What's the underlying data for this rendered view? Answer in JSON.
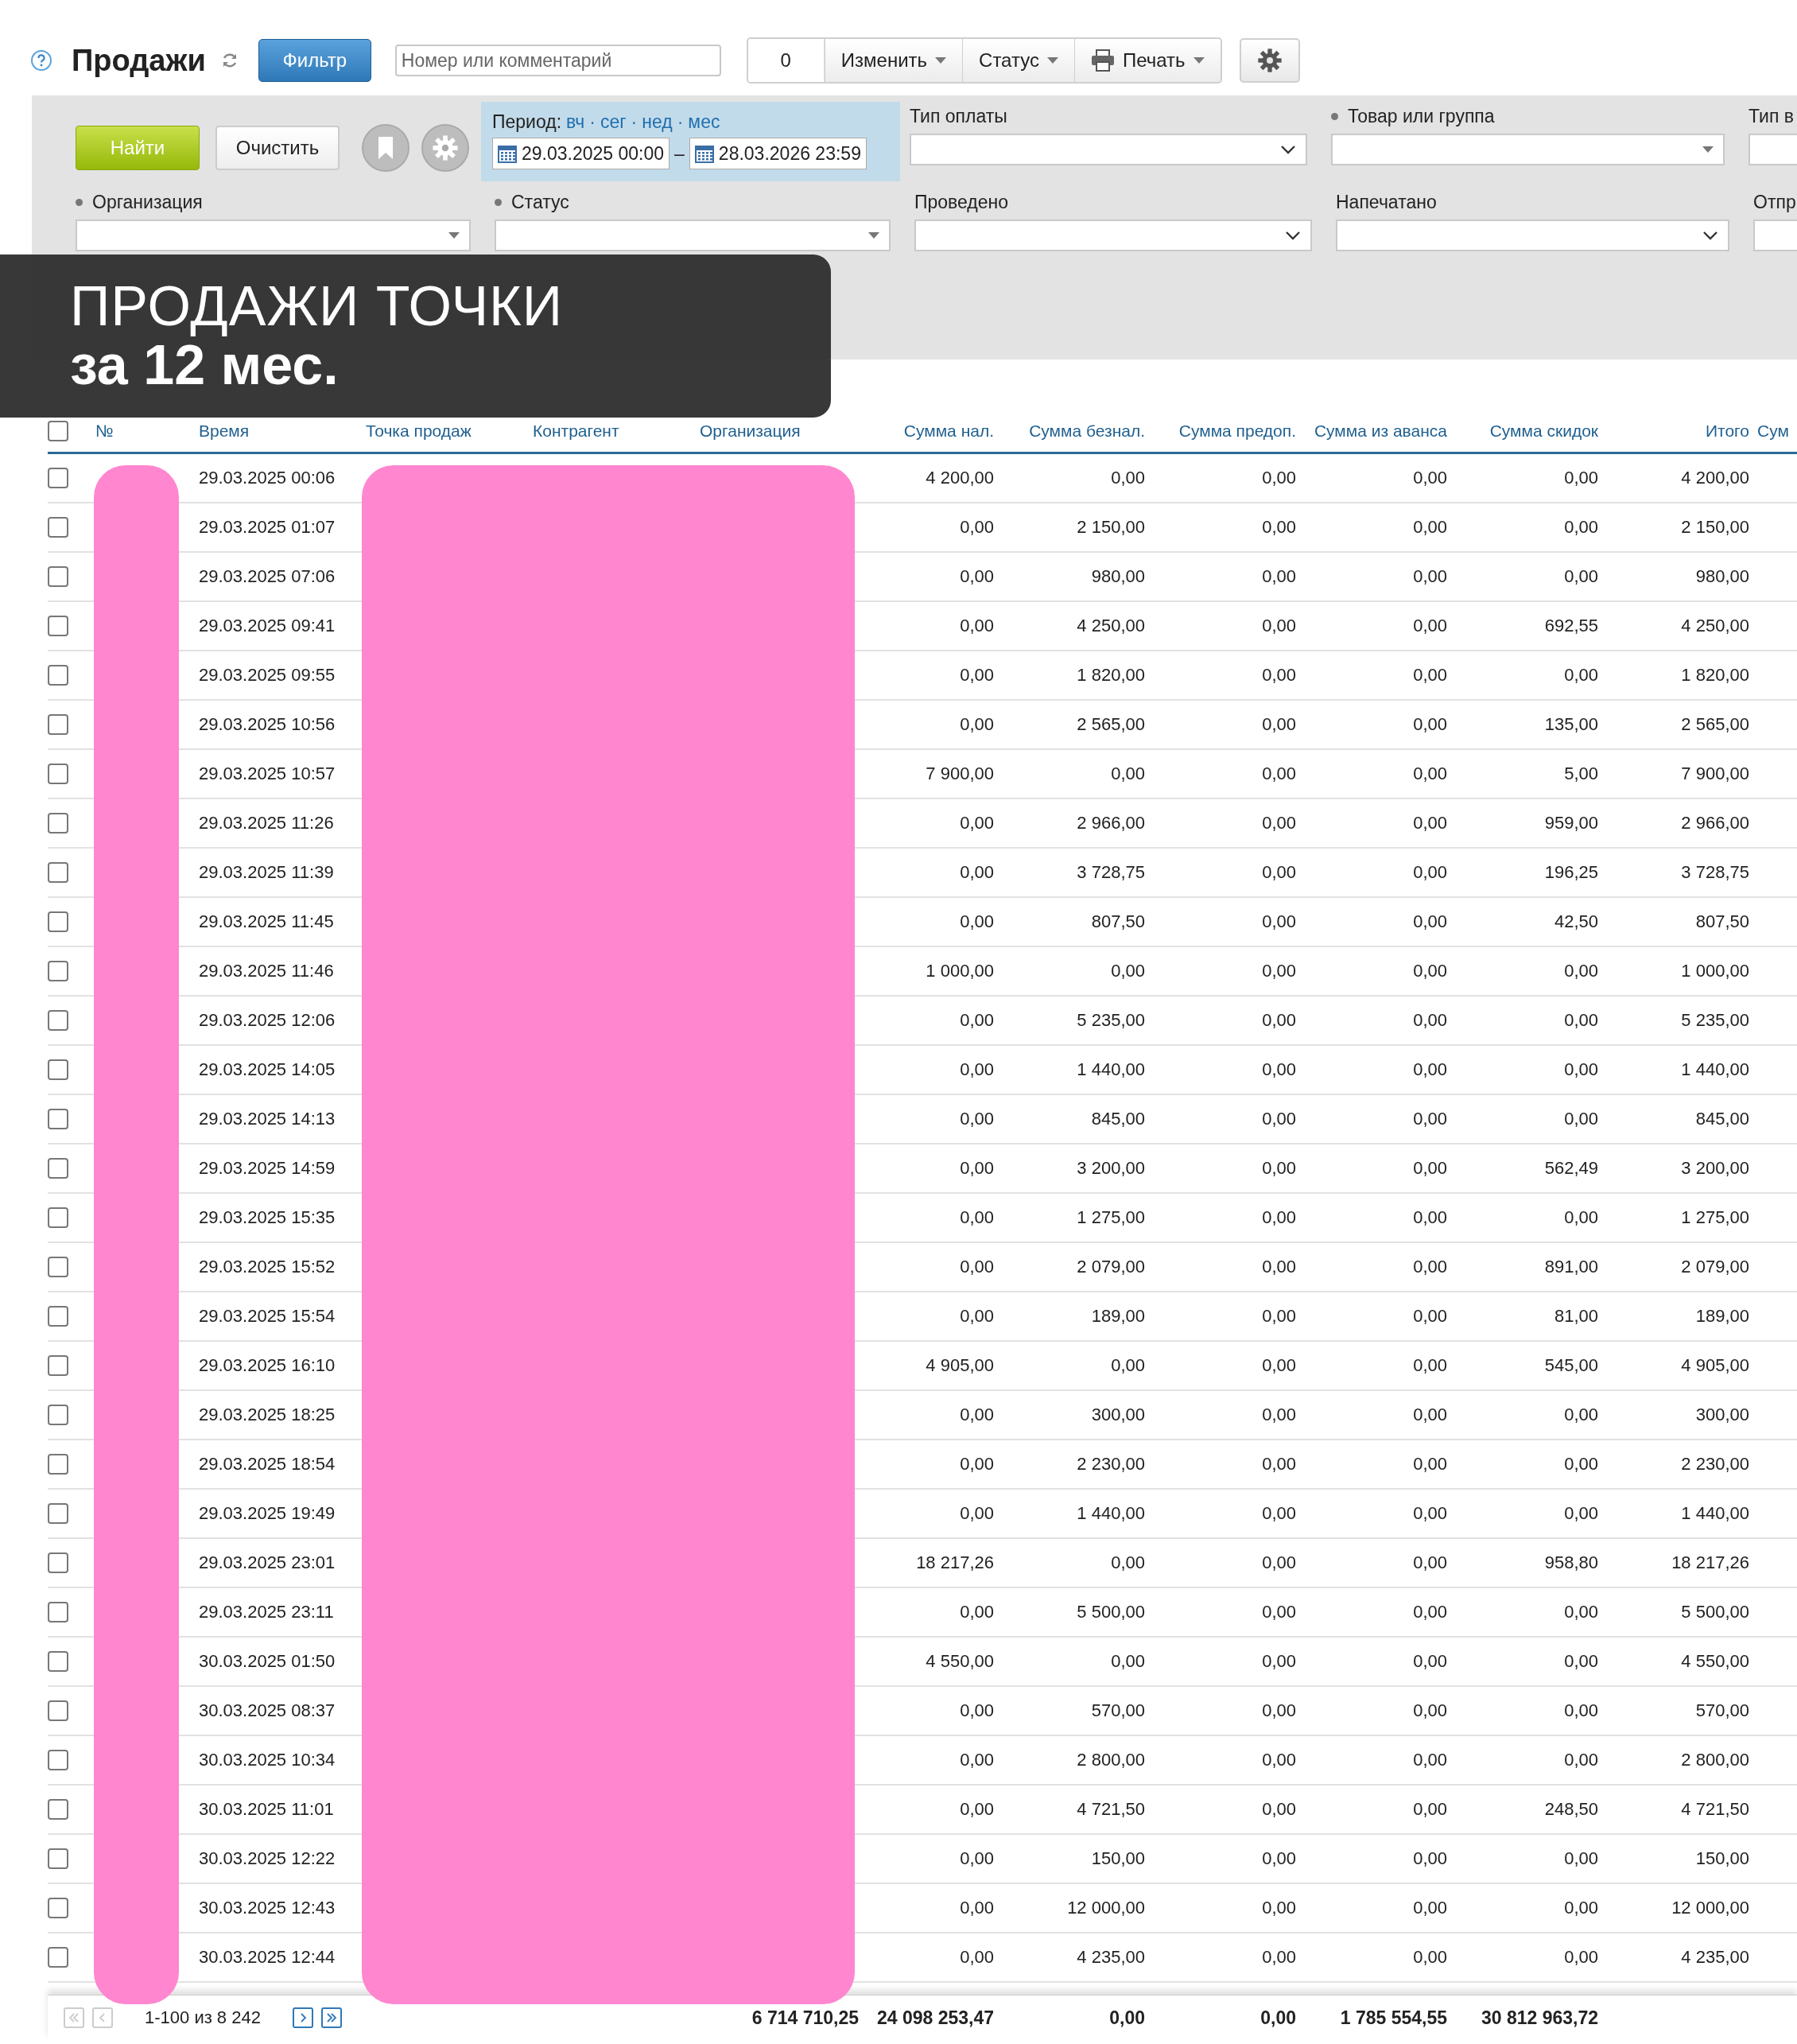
{
  "toolbar": {
    "title": "Продажи",
    "filter_button": "Фильтр",
    "search": {
      "placeholder": "Номер или комментарий"
    },
    "counter": "0",
    "menus": [
      {
        "label": "Изменить",
        "kind": "plain"
      },
      {
        "label": "Статус",
        "kind": "plain"
      },
      {
        "label": "Печать",
        "kind": "print"
      }
    ]
  },
  "filters": {
    "find_button": "Найти",
    "clear_button": "Очистить",
    "period": {
      "label": "Период:",
      "shortcuts": [
        "вч",
        "сег",
        "нед",
        "мес"
      ],
      "shortcut_separator": "·",
      "from": "29.03.2025 00:00",
      "separator": "–",
      "to": "28.03.2026 23:59"
    },
    "top_fields": [
      {
        "label": "Тип оплаты",
        "bullet": false,
        "kind": "select"
      },
      {
        "label": "Товар или группа",
        "bullet": true,
        "kind": "combo"
      },
      {
        "label": "Тип в",
        "bullet": false
      }
    ],
    "fields": [
      {
        "label": "Организация",
        "bullet": true,
        "kind": "combo"
      },
      {
        "label": "Статус",
        "bullet": true,
        "kind": "combo"
      },
      {
        "label": "Проведено",
        "bullet": false,
        "kind": "select"
      },
      {
        "label": "Напечатано",
        "bullet": false,
        "kind": "select"
      },
      {
        "label": "Отпр",
        "bullet": false
      }
    ]
  },
  "banner": {
    "title": "ПРОДАЖИ ТОЧКИ",
    "subtitle": "за 12 мес."
  },
  "table": {
    "header_checked": false,
    "columns": [
      "№",
      "Время",
      "Точка продаж",
      "Контрагент",
      "Организация",
      "Сумма нал.",
      "Сумма безнал.",
      "Сумма предоп.",
      "Сумма из аванса",
      "Сумма скидок",
      "Итого",
      "Сум"
    ],
    "rows": [
      {
        "checked": false,
        "time": "29.03.2025 00:06",
        "amounts": [
          "4 200,00",
          "0,00",
          "0,00",
          "0,00",
          "0,00",
          "4 200,00"
        ]
      },
      {
        "checked": false,
        "time": "29.03.2025 01:07",
        "amounts": [
          "0,00",
          "2 150,00",
          "0,00",
          "0,00",
          "0,00",
          "2 150,00"
        ]
      },
      {
        "checked": false,
        "time": "29.03.2025 07:06",
        "amounts": [
          "0,00",
          "980,00",
          "0,00",
          "0,00",
          "0,00",
          "980,00"
        ]
      },
      {
        "checked": false,
        "time": "29.03.2025 09:41",
        "amounts": [
          "0,00",
          "4 250,00",
          "0,00",
          "0,00",
          "692,55",
          "4 250,00"
        ]
      },
      {
        "checked": false,
        "time": "29.03.2025 09:55",
        "amounts": [
          "0,00",
          "1 820,00",
          "0,00",
          "0,00",
          "0,00",
          "1 820,00"
        ]
      },
      {
        "checked": false,
        "time": "29.03.2025 10:56",
        "amounts": [
          "0,00",
          "2 565,00",
          "0,00",
          "0,00",
          "135,00",
          "2 565,00"
        ]
      },
      {
        "checked": false,
        "time": "29.03.2025 10:57",
        "amounts": [
          "7 900,00",
          "0,00",
          "0,00",
          "0,00",
          "5,00",
          "7 900,00"
        ]
      },
      {
        "checked": false,
        "time": "29.03.2025 11:26",
        "amounts": [
          "0,00",
          "2 966,00",
          "0,00",
          "0,00",
          "959,00",
          "2 966,00"
        ]
      },
      {
        "checked": false,
        "time": "29.03.2025 11:39",
        "amounts": [
          "0,00",
          "3 728,75",
          "0,00",
          "0,00",
          "196,25",
          "3 728,75"
        ]
      },
      {
        "checked": false,
        "time": "29.03.2025 11:45",
        "amounts": [
          "0,00",
          "807,50",
          "0,00",
          "0,00",
          "42,50",
          "807,50"
        ]
      },
      {
        "checked": false,
        "time": "29.03.2025 11:46",
        "amounts": [
          "1 000,00",
          "0,00",
          "0,00",
          "0,00",
          "0,00",
          "1 000,00"
        ]
      },
      {
        "checked": false,
        "time": "29.03.2025 12:06",
        "amounts": [
          "0,00",
          "5 235,00",
          "0,00",
          "0,00",
          "0,00",
          "5 235,00"
        ]
      },
      {
        "checked": false,
        "time": "29.03.2025 14:05",
        "amounts": [
          "0,00",
          "1 440,00",
          "0,00",
          "0,00",
          "0,00",
          "1 440,00"
        ]
      },
      {
        "checked": false,
        "time": "29.03.2025 14:13",
        "amounts": [
          "0,00",
          "845,00",
          "0,00",
          "0,00",
          "0,00",
          "845,00"
        ]
      },
      {
        "checked": false,
        "time": "29.03.2025 14:59",
        "amounts": [
          "0,00",
          "3 200,00",
          "0,00",
          "0,00",
          "562,49",
          "3 200,00"
        ]
      },
      {
        "checked": false,
        "time": "29.03.2025 15:35",
        "amounts": [
          "0,00",
          "1 275,00",
          "0,00",
          "0,00",
          "0,00",
          "1 275,00"
        ]
      },
      {
        "checked": false,
        "time": "29.03.2025 15:52",
        "amounts": [
          "0,00",
          "2 079,00",
          "0,00",
          "0,00",
          "891,00",
          "2 079,00"
        ]
      },
      {
        "checked": false,
        "time": "29.03.2025 15:54",
        "amounts": [
          "0,00",
          "189,00",
          "0,00",
          "0,00",
          "81,00",
          "189,00"
        ]
      },
      {
        "checked": false,
        "time": "29.03.2025 16:10",
        "amounts": [
          "4 905,00",
          "0,00",
          "0,00",
          "0,00",
          "545,00",
          "4 905,00"
        ]
      },
      {
        "checked": false,
        "time": "29.03.2025 18:25",
        "amounts": [
          "0,00",
          "300,00",
          "0,00",
          "0,00",
          "0,00",
          "300,00"
        ]
      },
      {
        "checked": false,
        "time": "29.03.2025 18:54",
        "amounts": [
          "0,00",
          "2 230,00",
          "0,00",
          "0,00",
          "0,00",
          "2 230,00"
        ]
      },
      {
        "checked": false,
        "time": "29.03.2025 19:49",
        "amounts": [
          "0,00",
          "1 440,00",
          "0,00",
          "0,00",
          "0,00",
          "1 440,00"
        ]
      },
      {
        "checked": false,
        "time": "29.03.2025 23:01",
        "amounts": [
          "18 217,26",
          "0,00",
          "0,00",
          "0,00",
          "958,80",
          "18 217,26"
        ]
      },
      {
        "checked": false,
        "time": "29.03.2025 23:11",
        "amounts": [
          "0,00",
          "5 500,00",
          "0,00",
          "0,00",
          "0,00",
          "5 500,00"
        ]
      },
      {
        "checked": false,
        "time": "30.03.2025 01:50",
        "amounts": [
          "4 550,00",
          "0,00",
          "0,00",
          "0,00",
          "0,00",
          "4 550,00"
        ]
      },
      {
        "checked": false,
        "time": "30.03.2025 08:37",
        "amounts": [
          "0,00",
          "570,00",
          "0,00",
          "0,00",
          "0,00",
          "570,00"
        ]
      },
      {
        "checked": false,
        "time": "30.03.2025 10:34",
        "amounts": [
          "0,00",
          "2 800,00",
          "0,00",
          "0,00",
          "0,00",
          "2 800,00"
        ]
      },
      {
        "checked": false,
        "time": "30.03.2025 11:01",
        "amounts": [
          "0,00",
          "4 721,50",
          "0,00",
          "0,00",
          "248,50",
          "4 721,50"
        ]
      },
      {
        "checked": false,
        "time": "30.03.2025 12:22",
        "amounts": [
          "0,00",
          "150,00",
          "0,00",
          "0,00",
          "0,00",
          "150,00"
        ]
      },
      {
        "checked": false,
        "time": "30.03.2025 12:43",
        "amounts": [
          "0,00",
          "12 000,00",
          "0,00",
          "0,00",
          "0,00",
          "12 000,00"
        ]
      },
      {
        "checked": false,
        "time": "30.03.2025 12:44",
        "amounts": [
          "0,00",
          "4 235,00",
          "0,00",
          "0,00",
          "0,00",
          "4 235,00"
        ]
      }
    ],
    "totals": [
      "6 714 710,25",
      "24 098 253,47",
      "0,00",
      "0,00",
      "1 785 554,55",
      "30 812 963,72"
    ]
  },
  "pagination": {
    "range": "1-100 из 8 242",
    "first_disabled": true,
    "prev_disabled": true,
    "next_disabled": false,
    "last_disabled": false
  }
}
